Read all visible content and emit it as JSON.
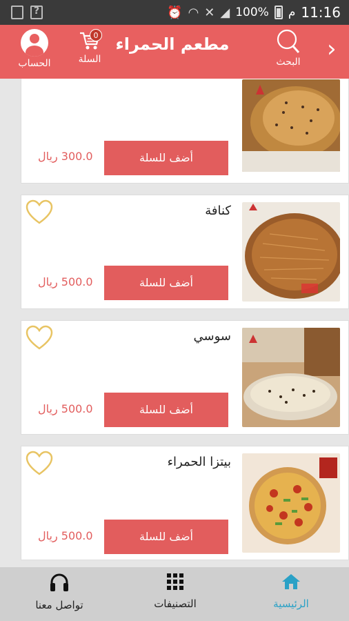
{
  "status_bar": {
    "time": "11:16",
    "am_pm": "م",
    "battery": "100%",
    "icons": [
      "image-icon",
      "unknown-icon",
      "alarm-icon",
      "wifi-icon",
      "no-signal-icon",
      "signal-icon",
      "battery-icon"
    ]
  },
  "header": {
    "title": "مطعم الحمراء",
    "account_label": "الحساب",
    "cart_label": "السلة",
    "cart_count": "0",
    "search_label": "البحث",
    "accent_color": "#e86060"
  },
  "products": [
    {
      "name": "",
      "price": "300.0 ريال",
      "add_label": "أضف للسلة"
    },
    {
      "name": "كنافة",
      "price": "500.0 ريال",
      "add_label": "أضف للسلة"
    },
    {
      "name": "سوسي",
      "price": "500.0 ريال",
      "add_label": "أضف للسلة"
    },
    {
      "name": "بيتزا الحمراء",
      "price": "500.0 ريال",
      "add_label": "أضف للسلة"
    }
  ],
  "bottom_nav": {
    "items": [
      {
        "label": "تواصل معنا",
        "icon": "headphones-icon"
      },
      {
        "label": "التصنيفات",
        "icon": "grid-icon"
      },
      {
        "label": "الرئيسية",
        "icon": "home-icon",
        "active": true
      }
    ],
    "active_color": "#2aa1c6"
  }
}
